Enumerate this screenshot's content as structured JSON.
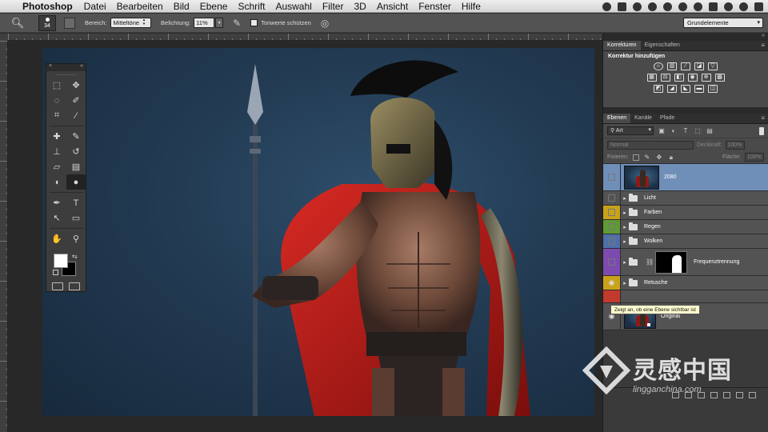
{
  "menubar": {
    "app_name": "Photoshop",
    "items": [
      "Datei",
      "Bearbeiten",
      "Bild",
      "Ebene",
      "Schrift",
      "Auswahl",
      "Filter",
      "3D",
      "Ansicht",
      "Fenster",
      "Hilfe"
    ]
  },
  "options": {
    "brush_size": "34",
    "bereich_label": "Bereich:",
    "bereich_value": "Mitteltöne",
    "belichtung_label": "Belichtung:",
    "belichtung_value": "11%",
    "tonwerte_label": "Tonwerte schützen",
    "workspace_value": "Grundelemente"
  },
  "panels": {
    "tab_korrekturen": "Korrekturen",
    "tab_eigenschaften": "Eigenschaften",
    "korrektur_title": "Korrektur hinzufügen",
    "tab_ebenen": "Ebenen",
    "tab_kanaele": "Kanäle",
    "tab_pfade": "Pfade",
    "filter_kind": "Art",
    "blend_mode": "Normal",
    "deckkraft_label": "Deckkraft:",
    "deckkraft_value": "100%",
    "fixieren_label": "Fixieren:",
    "flaeche_label": "Fläche:",
    "flaeche_value": "100%"
  },
  "layers": [
    {
      "name": "2080",
      "type": "image",
      "selected": true,
      "color": "#6f8fb9"
    },
    {
      "name": "Licht",
      "type": "group",
      "color": "#535353"
    },
    {
      "name": "Farben",
      "type": "group",
      "color": "#c9a21a"
    },
    {
      "name": "Regen",
      "type": "group",
      "color": "#5f9a35"
    },
    {
      "name": "Wolken",
      "type": "group",
      "color": "#4e6fa8"
    },
    {
      "name": "Frequenztrennung",
      "type": "group-mask",
      "color": "#7d4bb0"
    },
    {
      "name": "Retusche",
      "type": "group",
      "color": "#c9a21a"
    },
    {
      "name": "Original",
      "type": "image",
      "color": "#535353"
    }
  ],
  "tooltip": "Zeigt an, ob eine Ebene sichtbar ist",
  "watermark": {
    "text": "灵感中国",
    "url": "lingganchina.com"
  }
}
